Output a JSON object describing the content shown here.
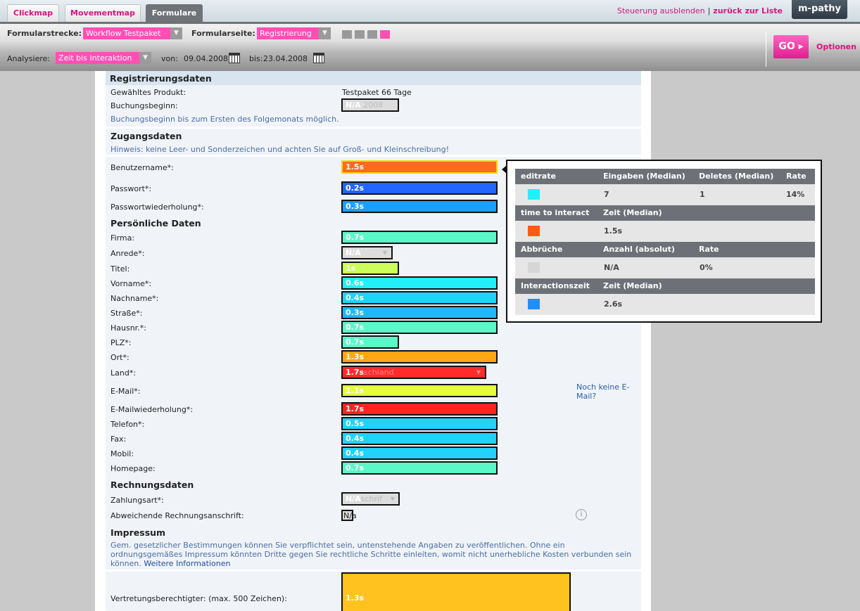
{
  "tabs": [
    {
      "label": "Clickmap",
      "active": false
    },
    {
      "label": "Movementmap",
      "active": false
    },
    {
      "label": "Formulare",
      "active": true
    }
  ],
  "toplinks": {
    "hide": "Steuerung ausblenden",
    "sep": "|",
    "back": "zurück zur Liste"
  },
  "logo": "m-pathy",
  "toolbar": {
    "formularstrecke_label": "Formularstrecke:",
    "formularstrecke_value": "Workflow Testpaket",
    "formularseite_label": "Formularseite:",
    "formularseite_value": "Registrierung",
    "analysiere_label": "Analysiere:",
    "analysiere_value": "Zeit bis Interaktion",
    "von_label": "von:",
    "von_value": "09.04.2008",
    "bis_label": "bis:",
    "bis_value": "23.04.2008",
    "go_label": "GO",
    "optionen_label": "Optionen",
    "steps_total": 4,
    "steps_active": 4
  },
  "form": {
    "sec_registrierung": "Registrierungsdaten",
    "produkt_label": "Gewähltes Produkt:",
    "produkt_value": "Testpaket 66 Tage",
    "buchungsbeginn_label": "Buchungsbeginn:",
    "buchungsbeginn_value": "N/A",
    "buchungsbeginn_ghost": ".2008",
    "buchungsbeginn_note": "Buchungsbeginn bis zum Ersten des Folgemonats möglich.",
    "sec_zugang": "Zugangsdaten",
    "zugang_note": "Hinweis: keine Leer- und Sonderzeichen und achten Sie auf Groß- und Kleinschreibung!",
    "benutzername_label": "Benutzername*:",
    "benutzername_value": "1.5s",
    "passwort_label": "Passwort*:",
    "passwort_value": "0.2s",
    "passwortw_label": "Passwortwiederholung*:",
    "passwortw_value": "0.3s",
    "sec_persoenlich": "Persönliche Daten",
    "firma_label": "Firma:",
    "firma_value": "0.7s",
    "anrede_label": "Anrede*:",
    "anrede_value": "N/A",
    "titel_label": "Titel:",
    "titel_value": "1s",
    "vorname_label": "Vorname*:",
    "vorname_value": "0.6s",
    "nachname_label": "Nachname*:",
    "nachname_value": "0.4s",
    "strasse_label": "Straße*:",
    "strasse_value": "0.3s",
    "hausnr_label": "Hausnr.*:",
    "hausnr_value": "0.7s",
    "plz_label": "PLZ*:",
    "plz_value": "0.7s",
    "ort_label": "Ort*:",
    "ort_value": "1.3s",
    "land_label": "Land*:",
    "land_value": "1.7s",
    "land_ghost": "schland",
    "email_label": "E-Mail*:",
    "email_value": "1.1s",
    "email_link": "Noch keine E-Mail?",
    "emailw_label": "E-Mailwiederholung*:",
    "emailw_value": "1.7s",
    "telefon_label": "Telefon*:",
    "telefon_value": "0.5s",
    "fax_label": "Fax:",
    "fax_value": "0.4s",
    "mobil_label": "Mobil:",
    "mobil_value": "0.4s",
    "homepage_label": "Homepage:",
    "homepage_value": "0.7s",
    "sec_rechnung": "Rechnungsdaten",
    "zahlungsart_label": "Zahlungsart*:",
    "zahlungsart_value": "N/A",
    "zahlungsart_ghost": "schrif",
    "abweichend_label": "Abweichende Rechnungsanschrift:",
    "abweichend_value": "N/a",
    "sec_impressum": "Impressum",
    "impressum_note": "Gem. gesetzlicher Bestimmungen können Sie verpflichtet sein, untenstehende Angaben zu veröffentlichen. Ohne ein ordnungsgemäßes Impressum könnten Dritte gegen Sie rechtliche Schritte einleiten, womit nicht unerhebliche Kosten verbunden sein können.",
    "impressum_link": "Weitere Informationen",
    "vertretung_label": "Vertretungsberechtigter: (max. 500 Zeichen):",
    "vertretung_value": "1.3s"
  },
  "popup": {
    "h1": [
      "editrate",
      "Eingaben (Median)",
      "Deletes (Median)",
      "Rate"
    ],
    "r1": [
      "7",
      "1",
      "14%"
    ],
    "h2": [
      "time to interact",
      "Zeit (Median)"
    ],
    "r2": [
      "1.5s"
    ],
    "h3": [
      "Abbrüche",
      "Anzahl (absolut)",
      "Rate"
    ],
    "r3": [
      "N/A",
      "0%"
    ],
    "h4": [
      "Interactionszeit",
      "Zeit (Median)"
    ],
    "r4": [
      "2.6s"
    ],
    "colors": {
      "editrate": "#22f0f8",
      "time": "#ff5a14",
      "abbrueche": "#d6d6d6",
      "interaction": "#1e8fff"
    }
  },
  "colors": {
    "accent": "#d6167f",
    "select_pink": "#ff4fb4"
  }
}
